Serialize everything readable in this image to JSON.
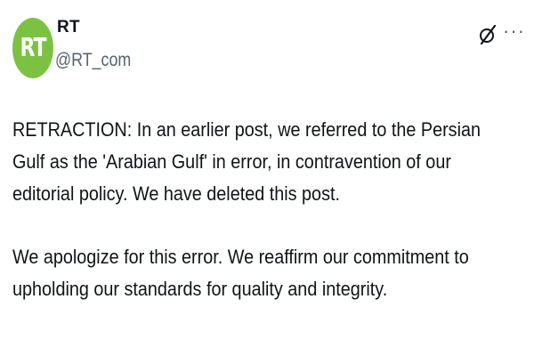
{
  "author": {
    "avatar_text": "RT",
    "avatar_color": "#7cc242",
    "display_name": "RT",
    "handle": "@RT_com"
  },
  "header_icons": {
    "grok": "grok-icon",
    "more": "more-icon",
    "more_glyph": "···"
  },
  "tweet": {
    "paragraphs": [
      "RETRACTION: In an earlier post, we referred to the Persian Gulf as the 'Arabian Gulf' in error, in contravention of our editorial policy. We have deleted this post.",
      "We apologize for this error. We reaffirm our commitment to upholding our standards for quality and integrity."
    ]
  },
  "colors": {
    "text": "#0f1419",
    "secondary": "#536471"
  }
}
